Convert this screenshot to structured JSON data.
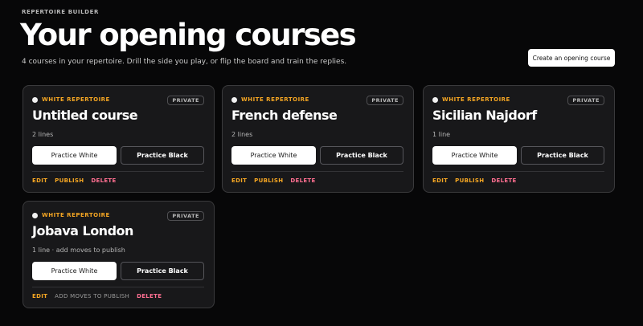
{
  "header": {
    "eyebrow": "REPERTOIRE BUILDER",
    "title": "Your opening courses",
    "subtitle": "4 courses in your repertoire. Drill the side you play, or flip the board and train the replies.",
    "create_label": "Create an opening course"
  },
  "colors": {
    "accent": "#f5a623",
    "danger": "#ff6f91",
    "card_bg": "#18181a",
    "page_bg": "#070708"
  },
  "courses": [
    {
      "tag": "WHITE REPERTOIRE",
      "privacy": "PRIVATE",
      "title": "Untitled course",
      "meta": "2 lines",
      "practice_white": "Practice White",
      "practice_black": "Practice Black",
      "edit": "EDIT",
      "publish": "PUBLISH",
      "delete": "DELETE"
    },
    {
      "tag": "WHITE REPERTOIRE",
      "privacy": "PRIVATE",
      "title": "French defense",
      "meta": "2 lines",
      "practice_white": "Practice White",
      "practice_black": "Practice Black",
      "edit": "EDIT",
      "publish": "PUBLISH",
      "delete": "DELETE"
    },
    {
      "tag": "WHITE REPERTOIRE",
      "privacy": "PRIVATE",
      "title": "Sicilian Najdorf",
      "meta": "1 line",
      "practice_white": "Practice White",
      "practice_black": "Practice Black",
      "edit": "EDIT",
      "publish": "PUBLISH",
      "delete": "DELETE"
    },
    {
      "tag": "WHITE REPERTOIRE",
      "privacy": "PRIVATE",
      "title": "Jobava London",
      "meta": "1 line · add moves to publish",
      "practice_white": "Practice White",
      "practice_black": "Practice Black",
      "edit": "EDIT",
      "publish_hint": "ADD MOVES TO PUBLISH",
      "delete": "DELETE"
    }
  ]
}
